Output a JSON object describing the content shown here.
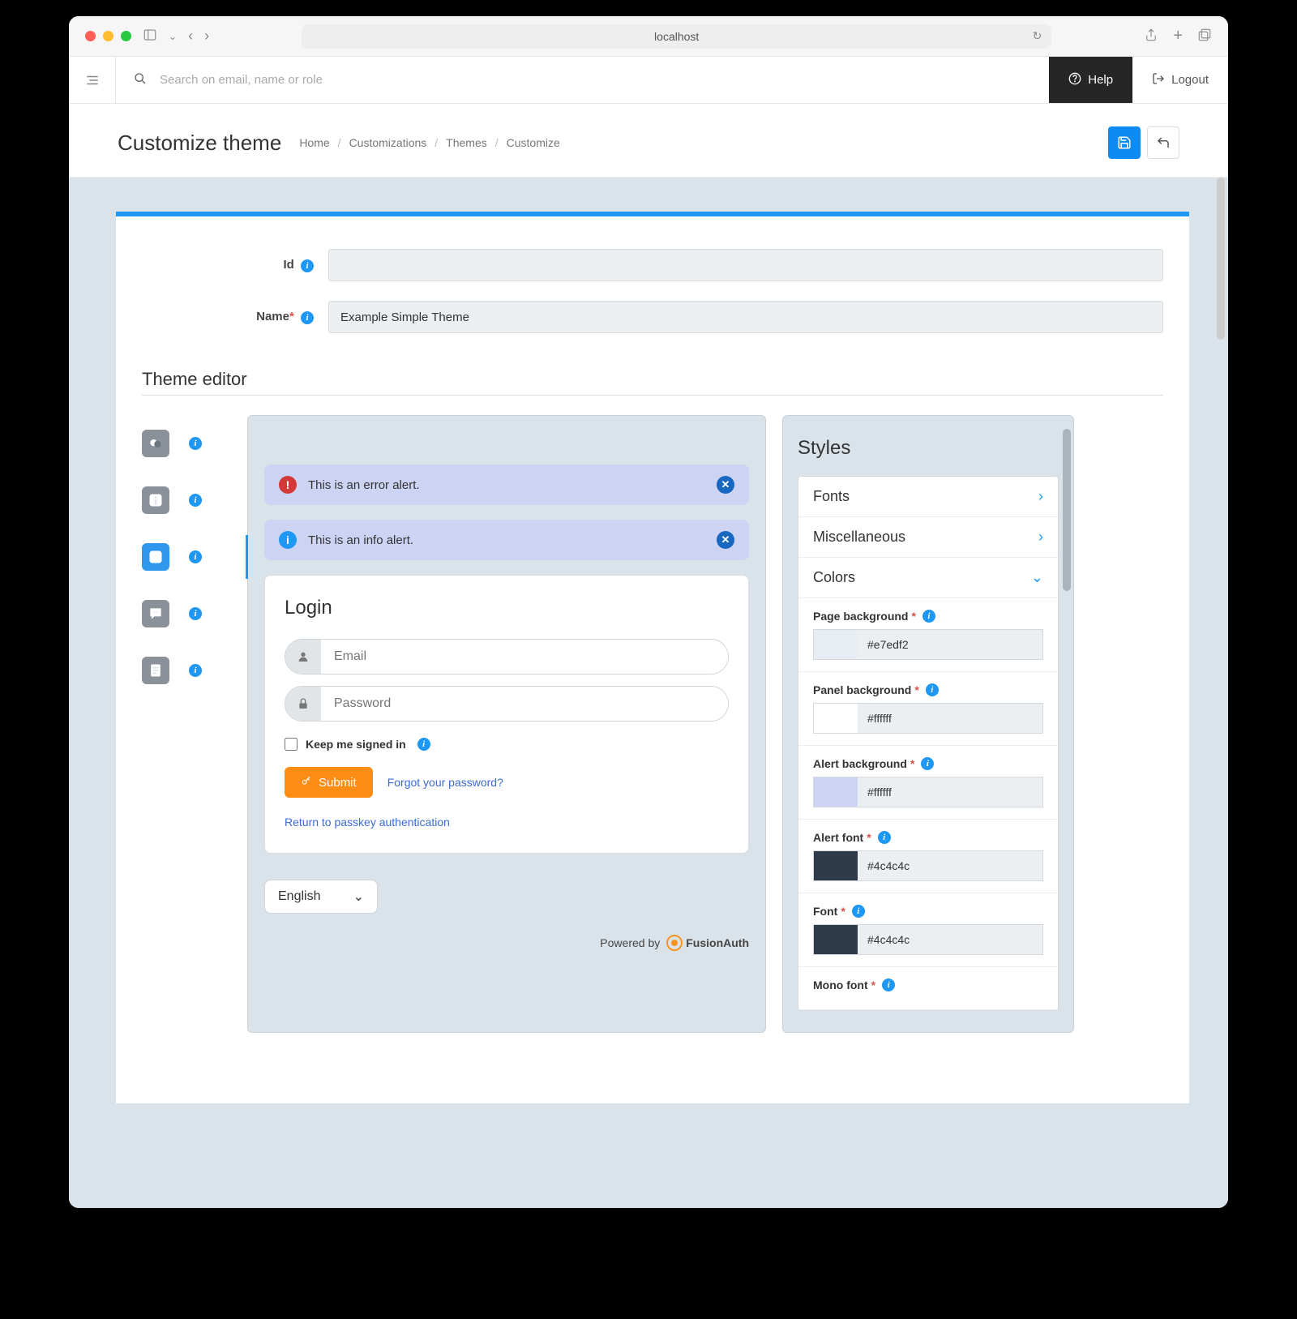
{
  "browser": {
    "url": "localhost"
  },
  "header": {
    "search_placeholder": "Search on email, name or role",
    "help": "Help",
    "logout": "Logout"
  },
  "page": {
    "title": "Customize theme",
    "breadcrumb": [
      "Home",
      "Customizations",
      "Themes",
      "Customize"
    ]
  },
  "form": {
    "id_label": "Id",
    "id_value": "",
    "name_label": "Name",
    "name_value": "Example Simple Theme"
  },
  "editor": {
    "section_title": "Theme editor"
  },
  "preview": {
    "error_alert": "This is an error alert.",
    "info_alert": "This is an info alert.",
    "login_title": "Login",
    "email_placeholder": "Email",
    "password_placeholder": "Password",
    "keep_signed": "Keep me signed in",
    "submit": "Submit",
    "forgot": "Forgot your password?",
    "passkey": "Return to passkey authentication",
    "language": "English",
    "powered": "Powered by",
    "brand": "FusionAuth"
  },
  "styles": {
    "title": "Styles",
    "sections": {
      "fonts": "Fonts",
      "misc": "Miscellaneous",
      "colors": "Colors"
    },
    "colors": [
      {
        "label": "Page background",
        "value": "#e7edf2",
        "swatch": "#e7edf2"
      },
      {
        "label": "Panel background",
        "value": "#ffffff",
        "swatch": "#ffffff"
      },
      {
        "label": "Alert background",
        "value": "#ffffff",
        "swatch": "#cdd4f3"
      },
      {
        "label": "Alert font",
        "value": "#4c4c4c",
        "swatch": "#2f3b4a"
      },
      {
        "label": "Font",
        "value": "#4c4c4c",
        "swatch": "#2f3b4a"
      },
      {
        "label": "Mono font",
        "value": "",
        "swatch": ""
      }
    ]
  }
}
